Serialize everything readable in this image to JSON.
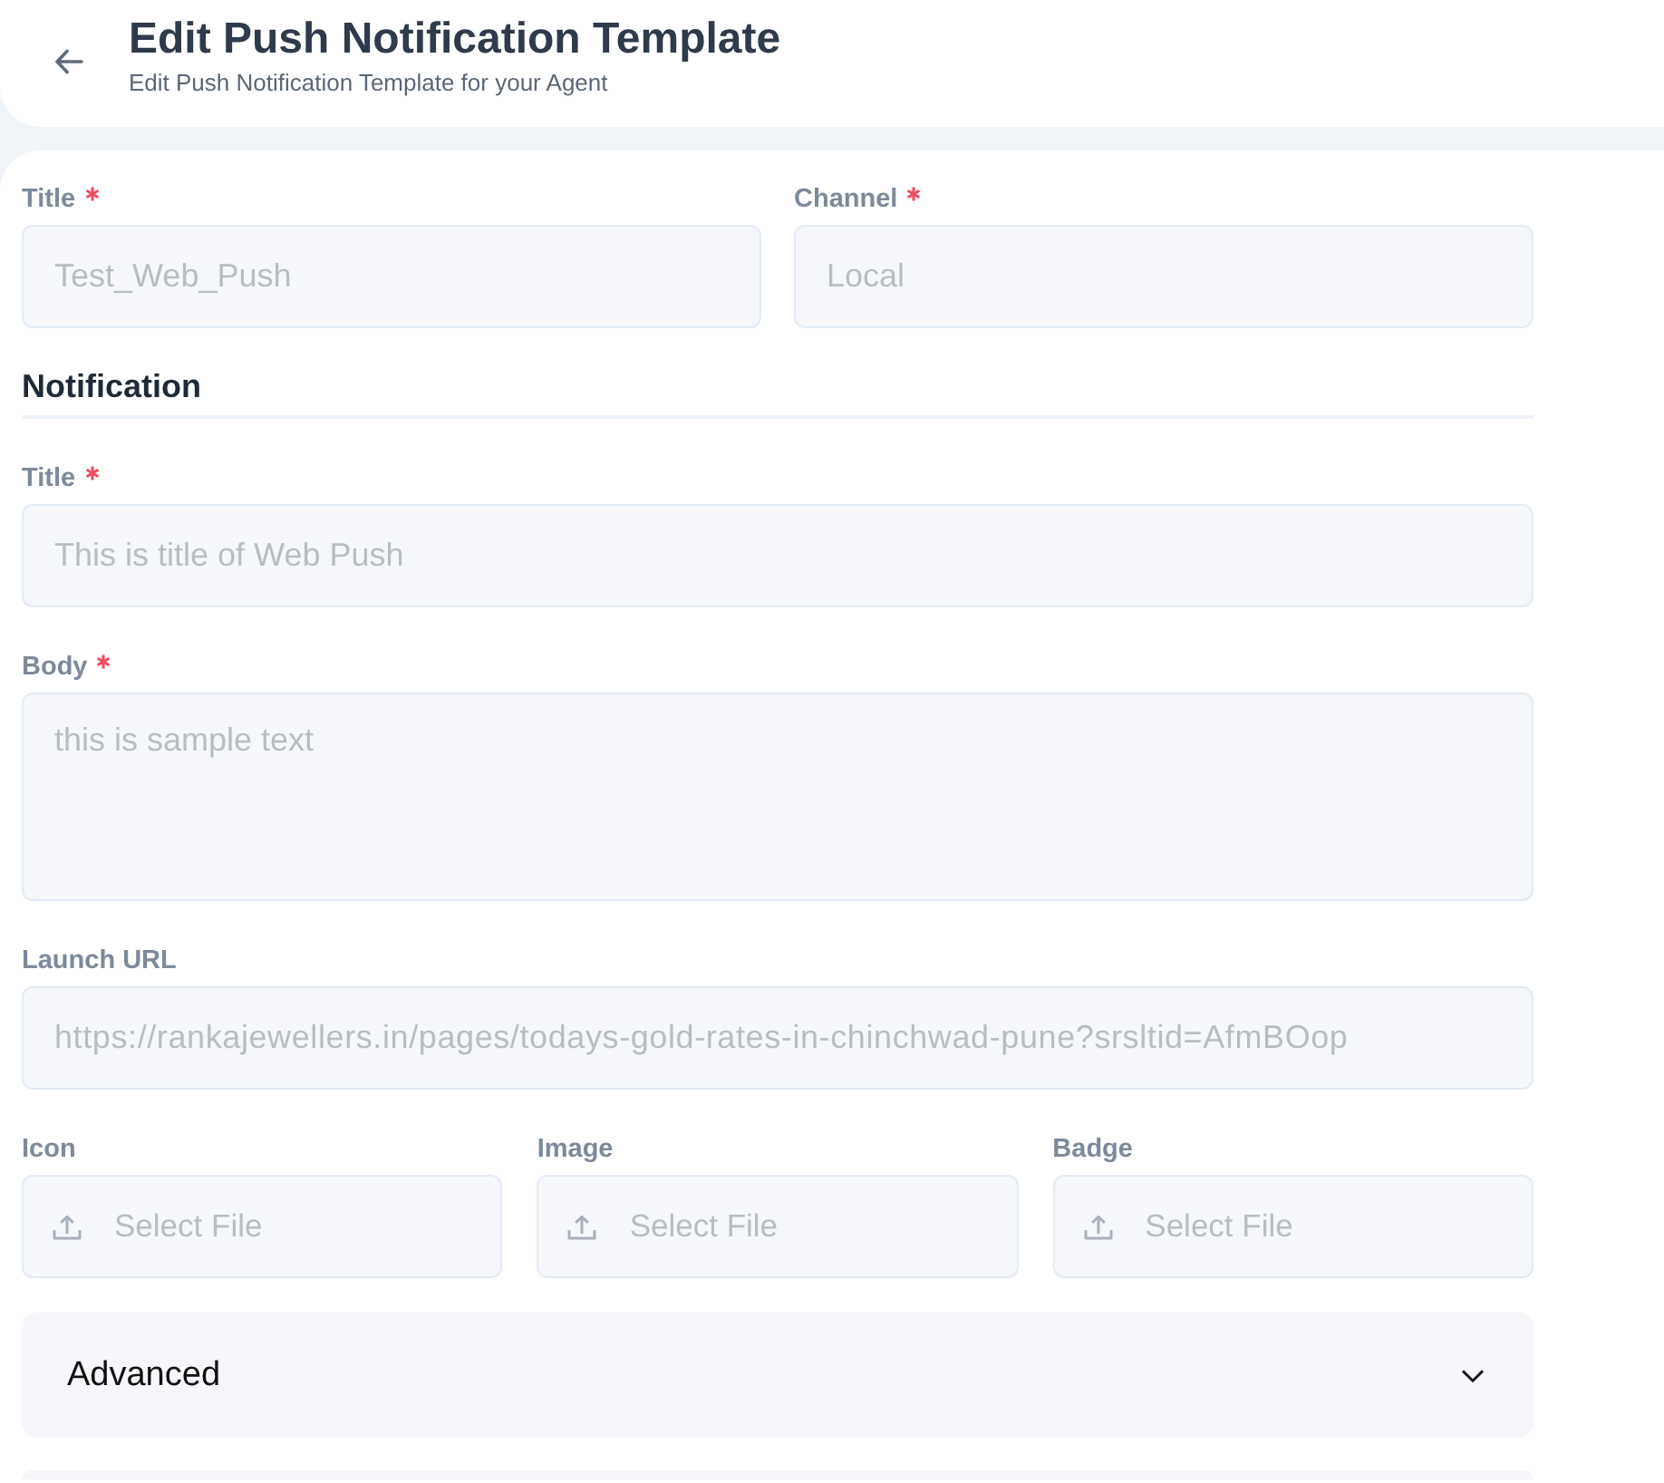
{
  "header": {
    "title": "Edit Push Notification Template",
    "subtitle": "Edit Push Notification Template for your Agent"
  },
  "general": [
    {
      "kind": "text",
      "label": "Title",
      "required": true,
      "value": "Test_Web_Push",
      "disabled": true
    },
    {
      "kind": "text",
      "label": "Channel",
      "required": true,
      "value": "Local",
      "disabled": true
    }
  ],
  "notification": {
    "heading": "Notification",
    "fields": [
      {
        "kind": "text",
        "label": "Title",
        "required": true,
        "value": "This is title of Web Push",
        "disabled": true
      },
      {
        "kind": "textarea",
        "label": "Body",
        "required": true,
        "value": "this is sample text",
        "disabled": true
      },
      {
        "kind": "text",
        "label": "Launch URL",
        "required": false,
        "value": "https://rankajewellers.in/pages/todays-gold-rates-in-chinchwad-pune?srsltid=AfmBOop",
        "disabled": true
      }
    ],
    "uploads": [
      {
        "label": "Icon",
        "button_label": "Select File"
      },
      {
        "label": "Image",
        "button_label": "Select File"
      },
      {
        "label": "Badge",
        "button_label": "Select File"
      }
    ]
  },
  "advanced": {
    "label": "Advanced",
    "expanded": false
  }
}
